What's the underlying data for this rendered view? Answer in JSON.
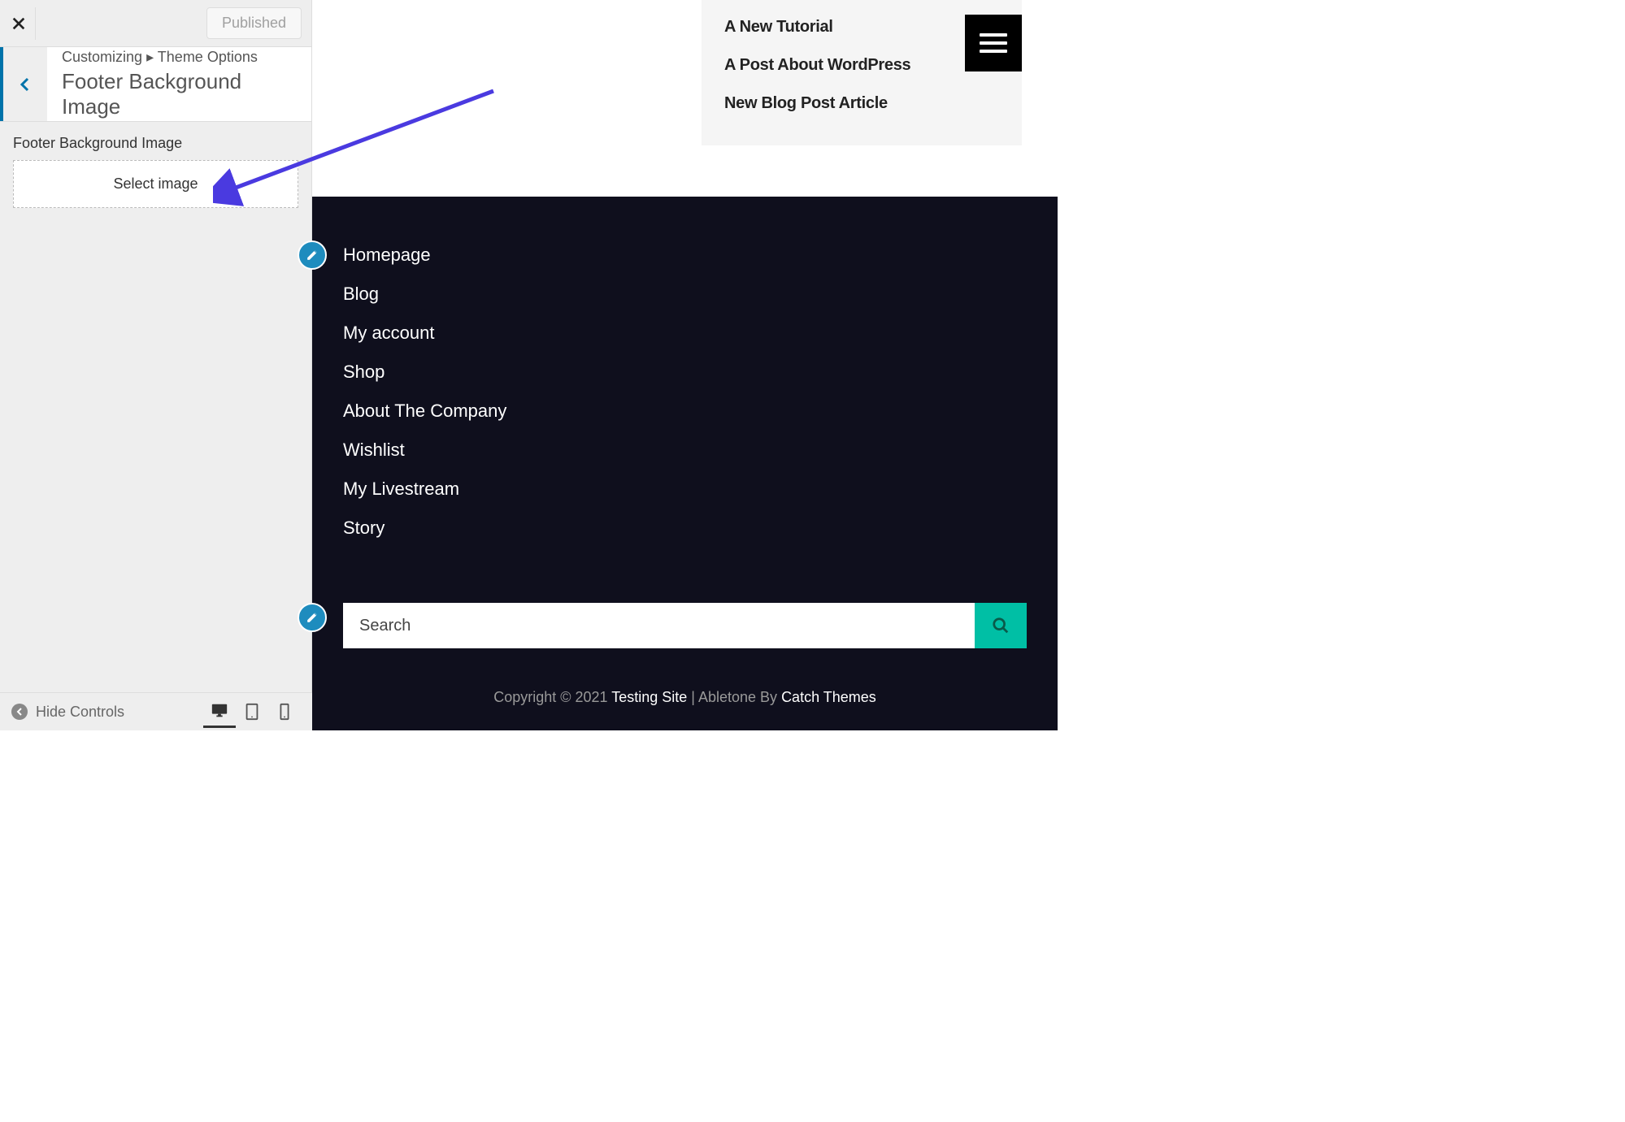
{
  "sidebar": {
    "publish_label": "Published",
    "breadcrumb_root": "Customizing",
    "breadcrumb_sep": "▸",
    "breadcrumb_section": "Theme Options",
    "panel_title": "Footer Background Image",
    "control_label": "Footer Background Image",
    "select_image_label": "Select image",
    "hide_controls_label": "Hide Controls"
  },
  "recent_posts": [
    "A New Tutorial",
    "A Post About WordPress",
    "New Blog Post Article"
  ],
  "footer_nav": [
    "Homepage",
    "Blog",
    "My account",
    "Shop",
    "About The Company",
    "Wishlist",
    "My Livestream",
    "Story"
  ],
  "search": {
    "placeholder": "Search"
  },
  "copyright": {
    "prefix": "Copyright © 2021 ",
    "site": "Testing Site",
    "mid": " | Abletone By ",
    "by": "Catch Themes"
  },
  "colors": {
    "footer_bg": "#0f0f1d",
    "search_btn": "#00bfa5",
    "edit_badge": "#1e8cbe",
    "arrow": "#4a3ae0"
  }
}
